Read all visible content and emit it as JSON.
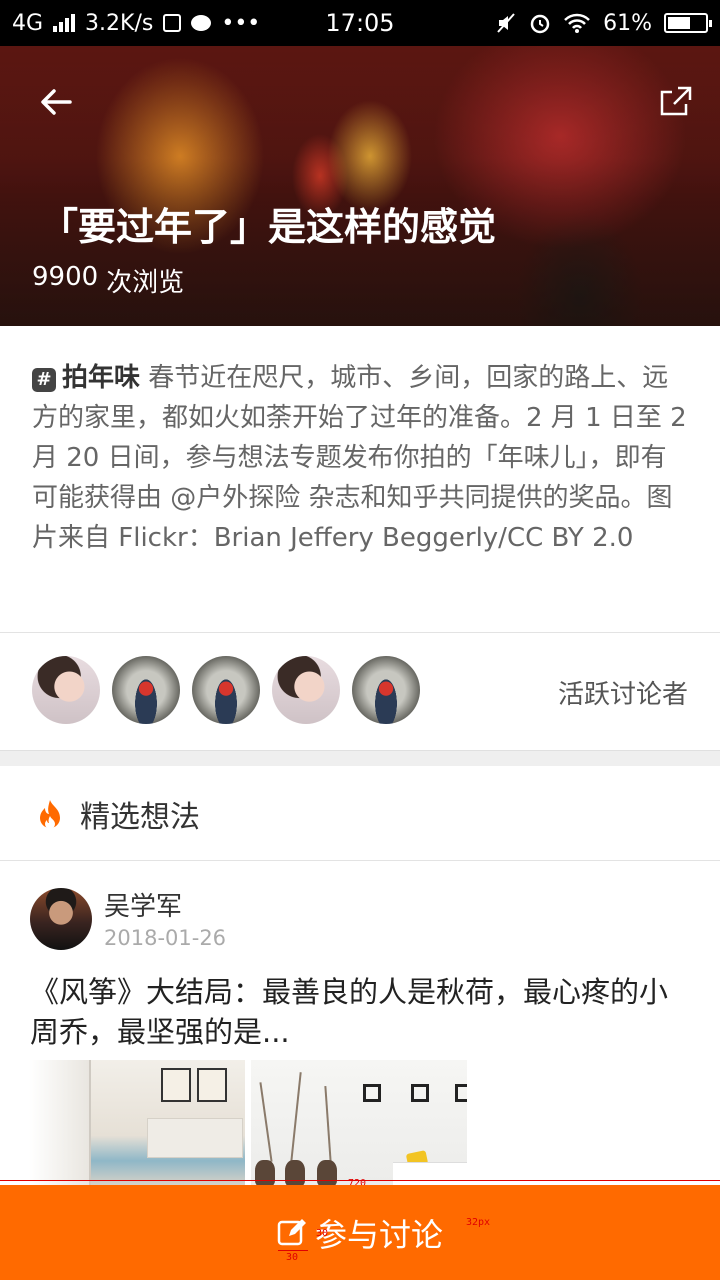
{
  "status_bar": {
    "network": "4G",
    "speed": "3.2K/s",
    "time": "17:05",
    "battery_pct": "61%",
    "battery_level": 0.61
  },
  "header": {
    "title": "「要过年了」是这样的感觉",
    "views_count": "9900",
    "views_label": "次浏览"
  },
  "description": {
    "tag": "拍年味",
    "text": "春节近在咫尺，城市、乡间，回家的路上、远方的家里，都如火如荼开始了过年的准备。2 月 1 日至 2 月 20 日间，参与想法专题发布你拍的「年味儿」，即有可能获得由 @户外探险 杂志和知乎共同提供的奖品。图片来自 Flickr：Brian Jeffery Beggerly/CC BY 2.0"
  },
  "participants": {
    "label": "活跃讨论者",
    "avatars": [
      "girl",
      "walker",
      "walker",
      "girl",
      "walker"
    ]
  },
  "featured": {
    "label": "精选想法"
  },
  "post": {
    "author": "吴学军",
    "date": "2018-01-26",
    "title": "《风筝》大结局：最善良的人是秋荷，最心疼的小周乔，最坚强的是..."
  },
  "bottom_bar": {
    "label": "参与讨论",
    "color": "#ff6a00"
  },
  "annotations": {
    "width": "720",
    "height": "95",
    "icon_w": "30",
    "icon_h": "30",
    "font_size": "32px"
  }
}
